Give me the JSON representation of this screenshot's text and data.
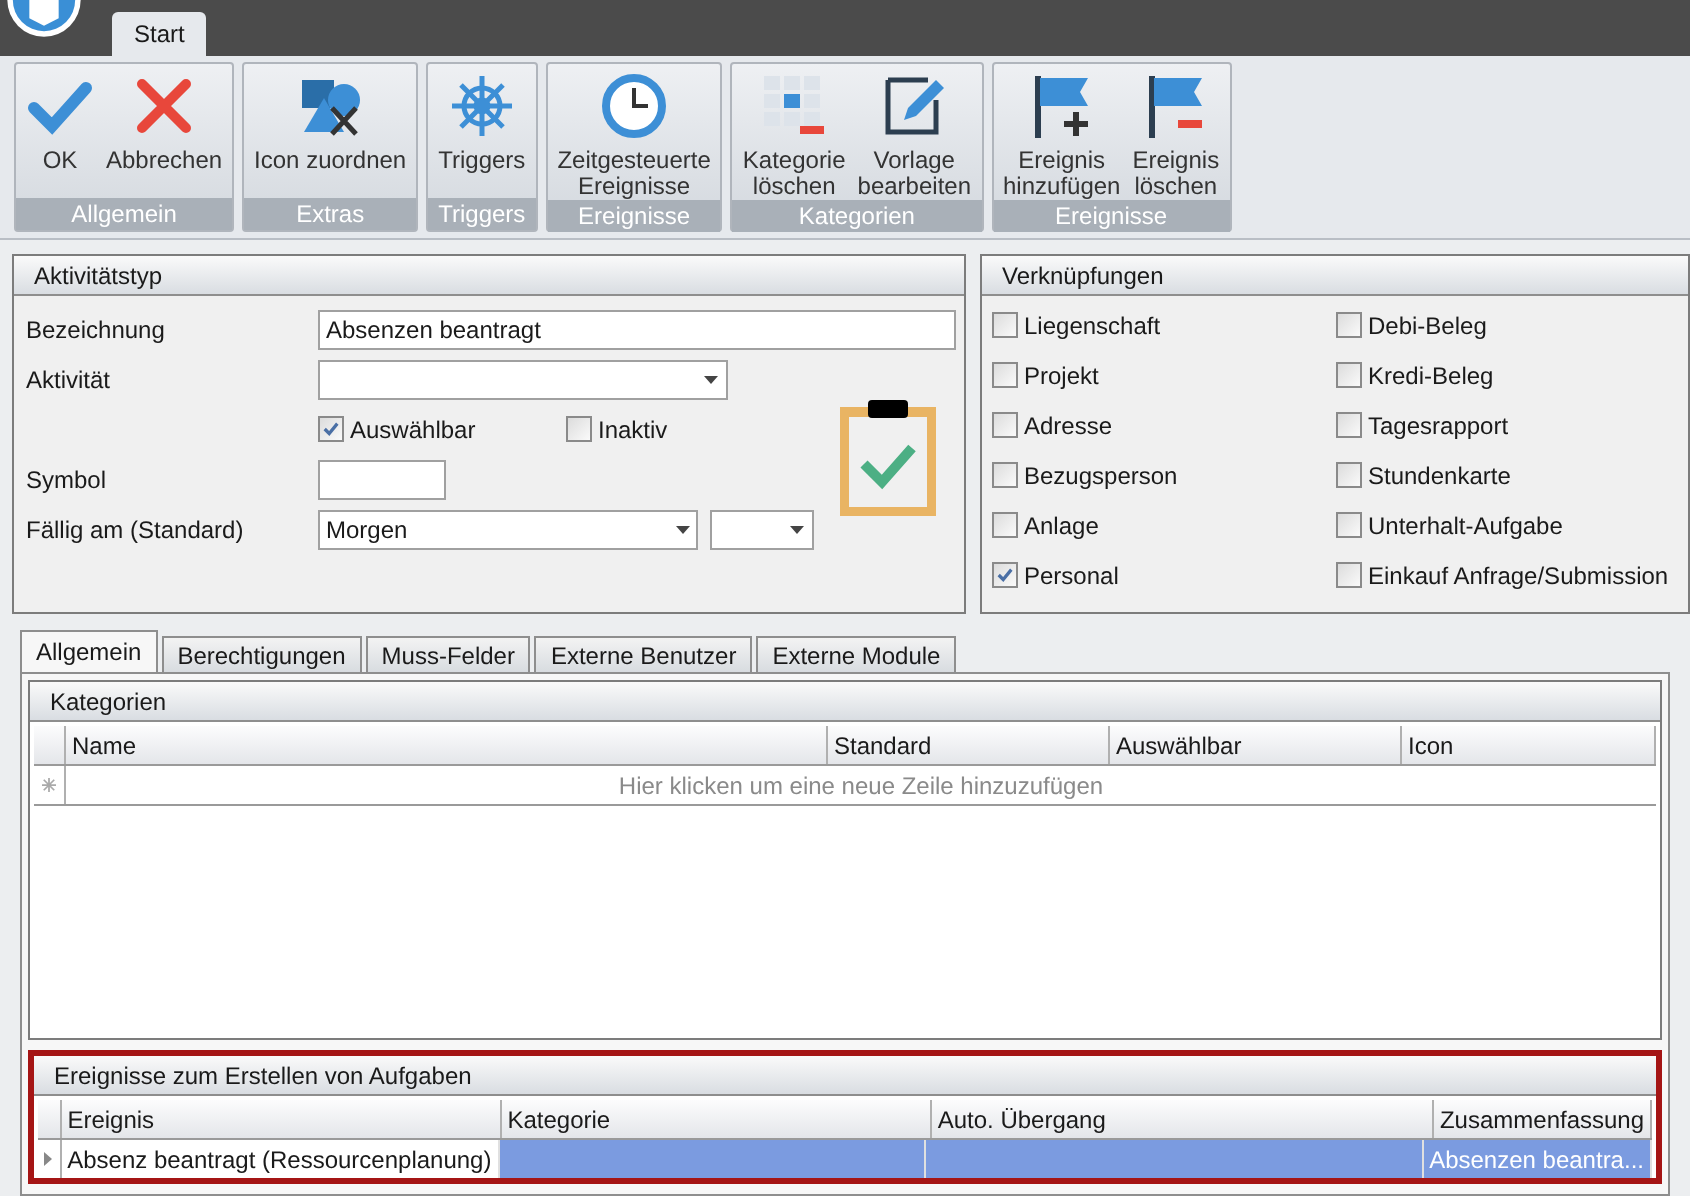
{
  "ribbon": {
    "tabs": [
      {
        "label": "Start",
        "selected": true
      }
    ],
    "groups": [
      {
        "label": "Allgemein",
        "buttons": [
          "OK",
          "Abbrechen"
        ]
      },
      {
        "label": "Extras",
        "buttons": [
          "Icon zuordnen"
        ]
      },
      {
        "label": "Triggers",
        "buttons": [
          "Triggers"
        ]
      },
      {
        "label": "Ereignisse",
        "buttons": [
          "Zeitgesteuerte\nEreignisse"
        ]
      },
      {
        "label": "Kategorien",
        "buttons": [
          "Kategorie\nlöschen",
          "Vorlage\nbearbeiten"
        ]
      },
      {
        "label": "Ereignisse",
        "buttons": [
          "Ereignis\nhinzufügen",
          "Ereignis\nlöschen"
        ]
      }
    ]
  },
  "aktivitaetstyp": {
    "title": "Aktivitätstyp",
    "bezeichnung": {
      "label": "Bezeichnung",
      "value": "Absenzen beantragt"
    },
    "aktivitaet": {
      "label": "Aktivität"
    },
    "checkboxes": [
      {
        "label": "Auswählbar",
        "checked": true
      },
      {
        "label": "Inaktiv",
        "checked": false
      }
    ],
    "symbol": {
      "label": "Symbol"
    },
    "faellig": {
      "label": "Fällig am (Standard)",
      "value": "Morgen"
    }
  },
  "verknuepfungen": {
    "title": "Verknüpfungen",
    "columns": [
      [
        {
          "label": "Liegenschaft",
          "checked": false
        },
        {
          "label": "Projekt",
          "checked": false
        },
        {
          "label": "Adresse",
          "checked": false
        },
        {
          "label": "Bezugsperson",
          "checked": false
        },
        {
          "label": "Anlage",
          "checked": false
        },
        {
          "label": "Personal",
          "checked": true
        }
      ],
      [
        {
          "label": "Debi-Beleg",
          "checked": false
        },
        {
          "label": "Kredi-Beleg",
          "checked": false
        },
        {
          "label": "Tagesrapport",
          "checked": false
        },
        {
          "label": "Stundenkarte",
          "checked": false
        },
        {
          "label": "Unterhalt-Aufgabe",
          "checked": false
        },
        {
          "label": "Einkauf Anfrage/Submission",
          "checked": false
        }
      ]
    ]
  },
  "tabs": [
    {
      "label": "Allgemein",
      "selected": true
    },
    {
      "label": "Berechtigungen",
      "selected": false
    },
    {
      "label": "Muss-Felder",
      "selected": false
    },
    {
      "label": "Externe Benutzer",
      "selected": false
    },
    {
      "label": "Externe Module",
      "selected": false
    }
  ],
  "kategorien": {
    "title": "Kategorien",
    "columns": [
      "Name",
      "Standard",
      "Auswählbar",
      "Icon"
    ],
    "new_row_hint": "Hier klicken um eine neue Zeile hinzuzufügen"
  },
  "ereignisse": {
    "title": "Ereignisse zum Erstellen von Aufgaben",
    "columns": [
      "Ereignis",
      "Kategorie",
      "Auto. Übergang",
      "Zusammenfassung"
    ],
    "rows": [
      {
        "cells": [
          "Absenz beantragt (Ressourcenplanung)",
          "",
          "",
          "Absenzen beantra..."
        ],
        "selected": true
      }
    ]
  }
}
